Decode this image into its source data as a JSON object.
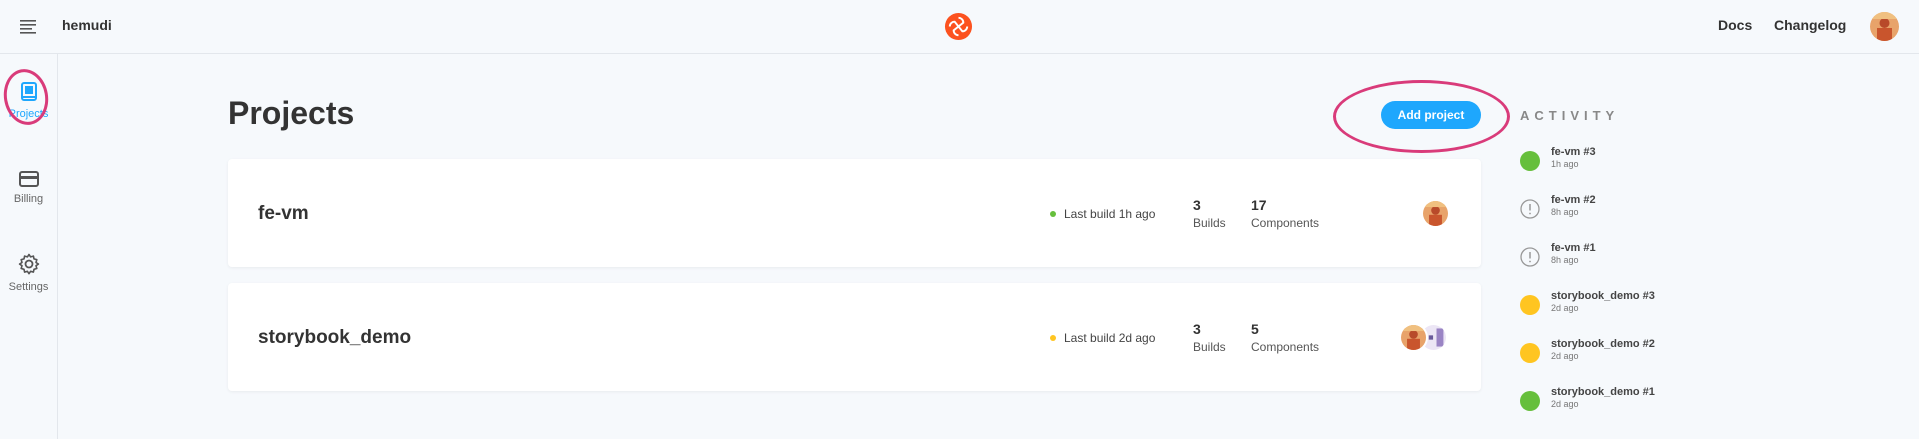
{
  "topbar": {
    "account_name": "hemudi",
    "nav_docs": "Docs",
    "nav_changelog": "Changelog",
    "menu_icon": "hamburger-menu-icon",
    "logo_icon": "chromatic-logo-icon"
  },
  "sidebar": {
    "items": [
      {
        "label": "Projects",
        "icon": "book-icon",
        "active": true
      },
      {
        "label": "Billing",
        "icon": "credit-card-icon",
        "active": false
      },
      {
        "label": "Settings",
        "icon": "gear-icon",
        "active": false
      }
    ]
  },
  "main": {
    "title": "Projects",
    "add_project_label": "Add project",
    "projects": [
      {
        "name": "fe-vm",
        "last_build": "Last build 1h ago",
        "status_color": "#66bf3c",
        "builds_value": "3",
        "builds_label": "Builds",
        "components_value": "17",
        "components_label": "Components"
      },
      {
        "name": "storybook_demo",
        "last_build": "Last build 2d ago",
        "status_color": "#ffc521",
        "builds_value": "3",
        "builds_label": "Builds",
        "components_value": "5",
        "components_label": "Components"
      }
    ]
  },
  "activity": {
    "heading": "ACTIVITY",
    "items": [
      {
        "name": "fe-vm #3",
        "time": "1h ago",
        "status": "passed"
      },
      {
        "name": "fe-vm #2",
        "time": "8h ago",
        "status": "error"
      },
      {
        "name": "fe-vm #1",
        "time": "8h ago",
        "status": "error"
      },
      {
        "name": "storybook_demo #3",
        "time": "2d ago",
        "status": "pending"
      },
      {
        "name": "storybook_demo #2",
        "time": "2d ago",
        "status": "pending"
      },
      {
        "name": "storybook_demo #1",
        "time": "2d ago",
        "status": "passed"
      }
    ]
  },
  "colors": {
    "accent": "#1ea7fd",
    "highlight": "#d93b7a",
    "passed": "#66bf3c",
    "pending": "#ffc521",
    "error": "#999999",
    "logo": "#fc521f"
  }
}
